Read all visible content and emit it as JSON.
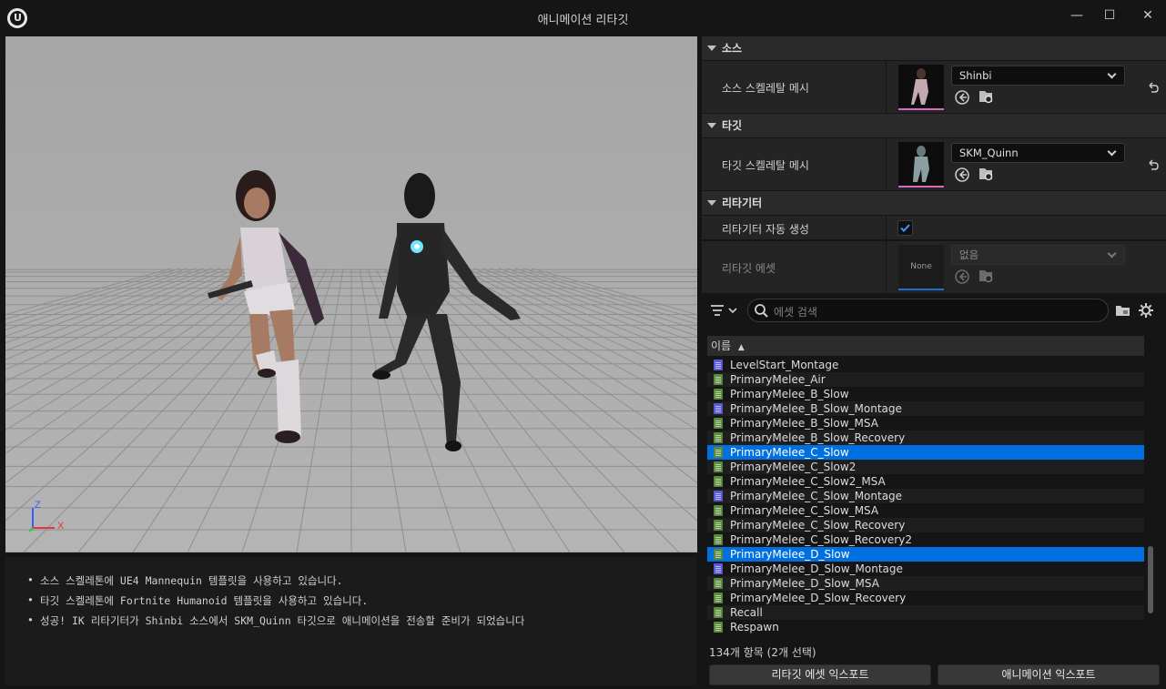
{
  "window": {
    "title": "애니메이션 리타깃",
    "minimize": "—",
    "maximize": "☐",
    "close": "✕"
  },
  "viewport": {
    "axis_z": "Z",
    "axis_x": "X"
  },
  "log": [
    "소스 스켈레톤에 UE4 Mannequin 템플릿을 사용하고 있습니다.",
    "타깃 스켈레톤에 Fortnite Humanoid 템플릿을 사용하고 있습니다.",
    "성공! IK 리타기터가 Shinbi 소스에서 SKM_Quinn 타깃으로 애니메이션을 전송할 준비가 되었습니다"
  ],
  "source": {
    "header": "소스",
    "label": "소스 스켈레탈 메시",
    "value": "Shinbi"
  },
  "target": {
    "header": "타깃",
    "label": "타깃 스켈레탈 메시",
    "value": "SKM_Quinn"
  },
  "retargeter": {
    "header": "리타기터",
    "auto_label": "리타기터 자동 생성",
    "auto_checked": true,
    "asset_label": "리타깃 에셋",
    "asset_thumb": "None",
    "asset_value": "없음"
  },
  "browser": {
    "search_placeholder": "에셋 검색",
    "column_name": "이름",
    "items": [
      {
        "name": "LevelStart_Montage",
        "kind": "montage",
        "selected": false
      },
      {
        "name": "PrimaryMelee_Air",
        "kind": "anim",
        "selected": false
      },
      {
        "name": "PrimaryMelee_B_Slow",
        "kind": "anim",
        "selected": false
      },
      {
        "name": "PrimaryMelee_B_Slow_Montage",
        "kind": "montage",
        "selected": false
      },
      {
        "name": "PrimaryMelee_B_Slow_MSA",
        "kind": "anim",
        "selected": false
      },
      {
        "name": "PrimaryMelee_B_Slow_Recovery",
        "kind": "anim",
        "selected": false
      },
      {
        "name": "PrimaryMelee_C_Slow",
        "kind": "anim",
        "selected": true
      },
      {
        "name": "PrimaryMelee_C_Slow2",
        "kind": "anim",
        "selected": false
      },
      {
        "name": "PrimaryMelee_C_Slow2_MSA",
        "kind": "anim",
        "selected": false
      },
      {
        "name": "PrimaryMelee_C_Slow_Montage",
        "kind": "montage",
        "selected": false
      },
      {
        "name": "PrimaryMelee_C_Slow_MSA",
        "kind": "anim",
        "selected": false
      },
      {
        "name": "PrimaryMelee_C_Slow_Recovery",
        "kind": "anim",
        "selected": false
      },
      {
        "name": "PrimaryMelee_C_Slow_Recovery2",
        "kind": "anim",
        "selected": false
      },
      {
        "name": "PrimaryMelee_D_Slow",
        "kind": "anim",
        "selected": true
      },
      {
        "name": "PrimaryMelee_D_Slow_Montage",
        "kind": "montage",
        "selected": false
      },
      {
        "name": "PrimaryMelee_D_Slow_MSA",
        "kind": "anim",
        "selected": false
      },
      {
        "name": "PrimaryMelee_D_Slow_Recovery",
        "kind": "anim",
        "selected": false
      },
      {
        "name": "Recall",
        "kind": "anim",
        "selected": false
      },
      {
        "name": "Respawn",
        "kind": "anim",
        "selected": false
      }
    ],
    "count": "134개 항목 (2개 선택)",
    "export_retarget": "리타깃 에셋 익스포트",
    "export_anim": "애니메이션 익스포트"
  },
  "colors": {
    "selection": "#0070e0",
    "anim_icon": "#5a8a3a",
    "montage_icon": "#5a5ad8",
    "checkbox_accent": "#1e7bd8",
    "thumb_accent": "#d86bc0"
  }
}
